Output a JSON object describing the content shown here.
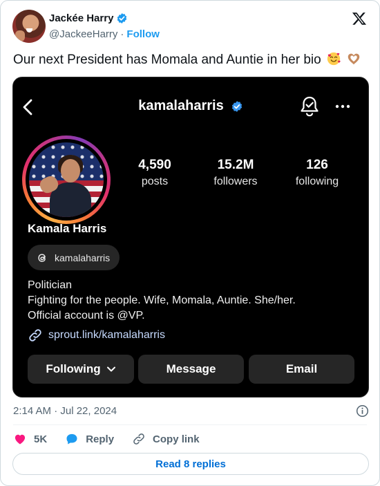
{
  "author": {
    "display_name": "Jackée Harry",
    "handle": "@JackeeHarry",
    "separator": "·",
    "follow_label": "Follow",
    "verified_icon": "verified-badge-icon"
  },
  "tweet": {
    "text": "Our next President has Momala and Auntie in her bio",
    "emojis": [
      "smiling-face-with-hearts-emoji",
      "heart-hands-emoji"
    ],
    "timestamp": "2:14 AM · Jul 22, 2024"
  },
  "instagram": {
    "username": "kamalaharris",
    "stats": [
      {
        "value": "4,590",
        "label": "posts"
      },
      {
        "value": "15.2M",
        "label": "followers"
      },
      {
        "value": "126",
        "label": "following"
      }
    ],
    "full_name": "Kamala Harris",
    "threads_handle": "kamalaharris",
    "bio_lines": [
      "Politician",
      "Fighting for the people. Wife, Momala, Auntie. She/her.",
      "Official account is @VP."
    ],
    "link": "sprout.link/kamalaharris",
    "buttons": {
      "following": "Following",
      "message": "Message",
      "email": "Email"
    }
  },
  "actions": {
    "likes": "5K",
    "reply": "Reply",
    "copy_link": "Copy link"
  },
  "read_replies": "Read 8 replies",
  "colors": {
    "verified_blue": "#1d9bf0",
    "link_blue": "#006fd6",
    "like_pink": "#f91880",
    "insta_bg": "#000000",
    "insta_button": "#262626"
  }
}
